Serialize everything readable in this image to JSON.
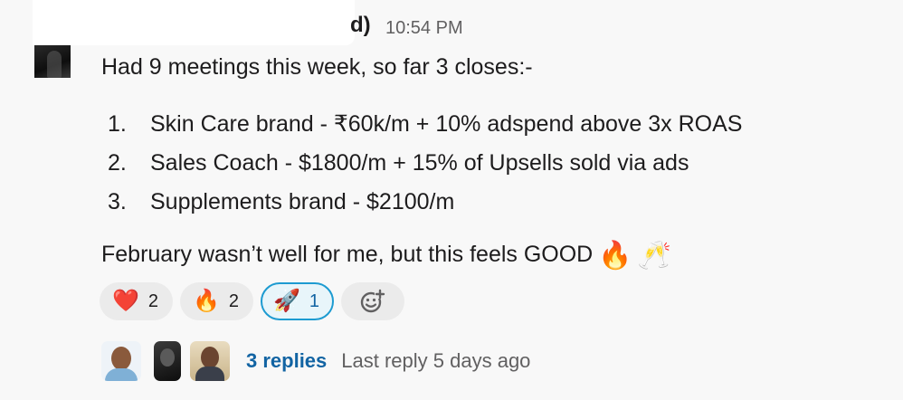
{
  "message": {
    "author_tail": "d)",
    "timestamp": "10:54 PM",
    "intro": "Had 9 meetings this week, so far 3 closes:-",
    "closes": [
      {
        "num": "1.",
        "text": "Skin Care brand - ₹60k/m + 10% adspend above 3x ROAS"
      },
      {
        "num": "2.",
        "text": "Sales Coach - $1800/m + 15% of Upsells sold via ads"
      },
      {
        "num": "3.",
        "text": "Supplements brand - $2100/m"
      }
    ],
    "closing": "February wasn’t well for me, but this feels GOOD",
    "closing_emojis": [
      "🔥",
      "🥂"
    ]
  },
  "reactions": [
    {
      "emoji": "❤️",
      "icon": "heart-icon",
      "count": "2",
      "active": false
    },
    {
      "emoji": "🔥",
      "icon": "fire-icon",
      "count": "2",
      "active": false
    },
    {
      "emoji": "🚀",
      "icon": "rocket-icon",
      "count": "1",
      "active": true
    }
  ],
  "add_reaction_icon": "add-reaction-icon",
  "thread": {
    "replies_label": "3 replies",
    "last_reply": "Last reply 5 days ago"
  },
  "colors": {
    "link": "#1264a3",
    "muted": "#616061",
    "active_border": "#1d9bd1"
  }
}
